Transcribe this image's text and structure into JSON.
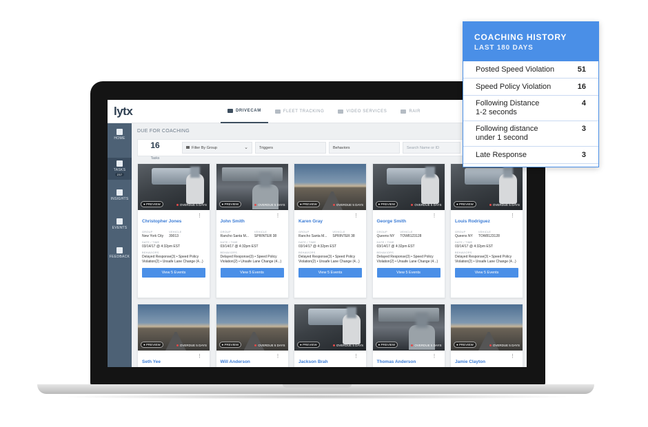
{
  "app": {
    "logo": "lytx",
    "nav_tabs": [
      {
        "label": "DRIVECAM",
        "active": true,
        "icon": "camera-icon"
      },
      {
        "label": "FLEET TRACKING",
        "active": false,
        "icon": "location-icon"
      },
      {
        "label": "VIDEO SERVICES",
        "active": false,
        "icon": "video-icon"
      },
      {
        "label": "RAIR",
        "active": false,
        "icon": "report-icon"
      }
    ],
    "sidebar": [
      {
        "label": "HOME",
        "icon": "home-icon"
      },
      {
        "label": "TASKS",
        "icon": "tasks-icon",
        "badge": "237",
        "active": true
      },
      {
        "label": "INSIGHTS",
        "icon": "insights-icon"
      },
      {
        "label": "EVENTS",
        "icon": "events-icon"
      },
      {
        "label": "FEEDBACK",
        "icon": "feedback-icon"
      }
    ],
    "section_title": "DUE FOR COACHING",
    "filters": {
      "task_count": "16",
      "task_label": "Tasks",
      "group": "Filter By Group",
      "triggers": "Triggers",
      "behaviors": "Behaviors",
      "search_placeholder": "Search Name or ID"
    },
    "labels": {
      "group": "GROUP",
      "vehicle": "VEHICLE",
      "date_time": "DATE / TIME",
      "behaviors": "BEHAVIORS",
      "preview": "PREVIEW",
      "overdue": "OVERDUE 5 DAYS",
      "view_events": "View 5 Events",
      "kebab": "⋮"
    },
    "cards": [
      {
        "name": "Christopher Jones",
        "thumb": "cab",
        "group": "New York City",
        "vehicle": "39013",
        "datetime": "03/14/17 @ 4:32pm EST",
        "behaviors": "Delayed Response(3) • Speed Policy Violation(2) • Unsafe Lane Change (4...)"
      },
      {
        "name": "John Smith",
        "thumb": "van",
        "group": "Rancho Santa M...",
        "vehicle": "SPRINTER 38",
        "datetime": "03/14/17 @ 4:32pm EST",
        "behaviors": "Delayed Response(3) • Speed Policy Violation(2) • Unsafe Lane Change (4...)"
      },
      {
        "name": "Karen Gray",
        "thumb": "road",
        "group": "Rancho Santa M...",
        "vehicle": "SPRINTER 38",
        "datetime": "03/14/17 @ 4:32pm EST",
        "behaviors": "Delayed Response(3) • Speed Policy Violation(2) • Unsafe Lane Change (4...)"
      },
      {
        "name": "George Smith",
        "thumb": "cab",
        "group": "Queens NY",
        "vehicle": "TOW8123128",
        "datetime": "03/14/17 @ 4:32pm EST",
        "behaviors": "Delayed Response(3) • Speed Policy Violation(2) • Unsafe Lane Change (4...)"
      },
      {
        "name": "Louis Rodriguez",
        "thumb": "cab",
        "group": "Queens NY",
        "vehicle": "TOW8123128",
        "datetime": "03/14/17 @ 4:32pm EST",
        "behaviors": "Delayed Response(3) • Speed Policy Violation(2) • Unsafe Lane Change (4...)"
      },
      {
        "name": "Seth Yee",
        "thumb": "road"
      },
      {
        "name": "Will Anderson",
        "thumb": "road"
      },
      {
        "name": "Jackson Brah",
        "thumb": "cab"
      },
      {
        "name": "Thomas Anderson",
        "thumb": "van"
      },
      {
        "name": "Jamie Clayton",
        "thumb": "road"
      }
    ]
  },
  "coaching_history": {
    "title": "COACHING HISTORY",
    "subtitle": "LAST 180 DAYS",
    "rows": [
      {
        "label": "Posted Speed Violation",
        "value": "51"
      },
      {
        "label": "Speed Policy Violation",
        "value": "16"
      },
      {
        "label": "Following Distance\n1-2 seconds",
        "value": "4"
      },
      {
        "label": "Following distance\nunder 1 second",
        "value": "3"
      },
      {
        "label": "Late Response",
        "value": "3"
      }
    ]
  },
  "colors": {
    "accent": "#4a8fe7",
    "sidebar": "#4d6175",
    "overdue_dot": "#e24a4a"
  }
}
